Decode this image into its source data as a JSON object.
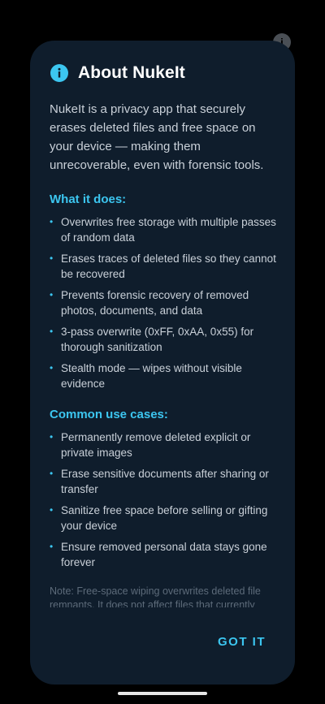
{
  "background": {
    "icon": "info-icon"
  },
  "dialog": {
    "icon": "info-icon",
    "title": "About NukeIt",
    "intro": "NukeIt is a privacy app that securely erases deleted files and free space on your device — making them unrecoverable, even with forensic tools.",
    "sections": [
      {
        "heading": "What it does:",
        "items": [
          "Overwrites free storage with multiple passes of random data",
          "Erases traces of deleted files so they cannot be recovered",
          "Prevents forensic recovery of removed photos, documents, and data",
          "3-pass overwrite (0xFF, 0xAA, 0x55) for thorough sanitization",
          "Stealth mode — wipes without visible evidence"
        ]
      },
      {
        "heading": "Common use cases:",
        "items": [
          "Permanently remove deleted explicit or private images",
          "Erase sensitive documents after sharing or transfer",
          "Sanitize free space before selling or gifting your device",
          "Ensure removed personal data stays gone forever"
        ]
      }
    ],
    "note": "Note: Free-space wiping overwrites deleted file remnants. It does not affect files that currently",
    "button_label": "GOT IT"
  },
  "colors": {
    "accent": "#3cc6f0",
    "dialog_bg": "#0f1d2c",
    "text": "#c9d0d8"
  }
}
